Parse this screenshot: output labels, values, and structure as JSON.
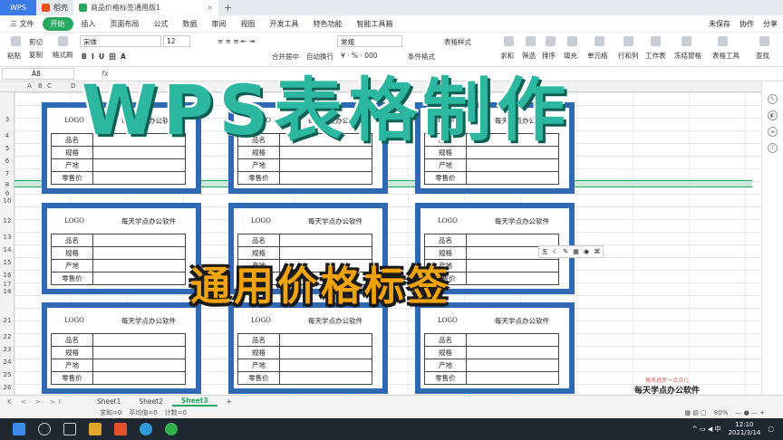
{
  "titlebar": {
    "tabs": [
      {
        "label": "WPS"
      },
      {
        "label": "稻壳"
      },
      {
        "label": "商品价格标签通用版1"
      }
    ]
  },
  "menu": {
    "items": [
      "三 文件",
      "开始",
      "插入",
      "页面布局",
      "公式",
      "数据",
      "审阅",
      "视图",
      "开发工具",
      "特色功能",
      "智能工具箱"
    ],
    "right": [
      "未保存",
      "协作",
      "分享"
    ]
  },
  "ribbon": {
    "cut": "剪切",
    "paste": "粘贴",
    "copy": "复制",
    "format_painter": "格式刷",
    "font": "宋体",
    "font_size": "12",
    "merge": "合并居中",
    "wrap": "自动换行",
    "number_format": "常规",
    "conditional": "条件格式",
    "table_style": "表格样式",
    "sum": "求和",
    "filter": "筛选",
    "sort": "排序",
    "fill": "填充",
    "cell": "单元格",
    "row_col": "行和列",
    "worksheet": "工作表",
    "freeze": "冻结窗格",
    "table_tools": "表格工具",
    "find": "查找"
  },
  "formula_bar": {
    "cell_ref": "A8",
    "fx": "fx"
  },
  "columns": [
    "A",
    "B",
    "C",
    "D"
  ],
  "rows": [
    "3",
    "4",
    "5",
    "6",
    "7",
    "8",
    "9",
    "10",
    "12",
    "13",
    "14",
    "15",
    "16",
    "17",
    "18",
    "21",
    "22",
    "23",
    "24",
    "25",
    "26"
  ],
  "overlay": {
    "title": "WPS表格制作",
    "subtitle": "通用价格标签"
  },
  "card": {
    "logo": "LOGO",
    "company": "每天学点办公软件",
    "fields": [
      "品名",
      "规格",
      "产地",
      "零售价"
    ]
  },
  "float_toolbar": [
    "五",
    "☾",
    "✎",
    "▦",
    "◉",
    "⌘"
  ],
  "watermark": {
    "small": "每天进步一点点儿",
    "big": "每天学点办公软件"
  },
  "sheets": [
    "Sheet1",
    "Sheet2",
    "Sheet3"
  ],
  "status": {
    "sum": "求和=0",
    "avg": "平均值=0",
    "count": "计数=0",
    "zoom": "80%"
  },
  "taskbar": {
    "time": "12:10",
    "date": "2021/3/14"
  }
}
